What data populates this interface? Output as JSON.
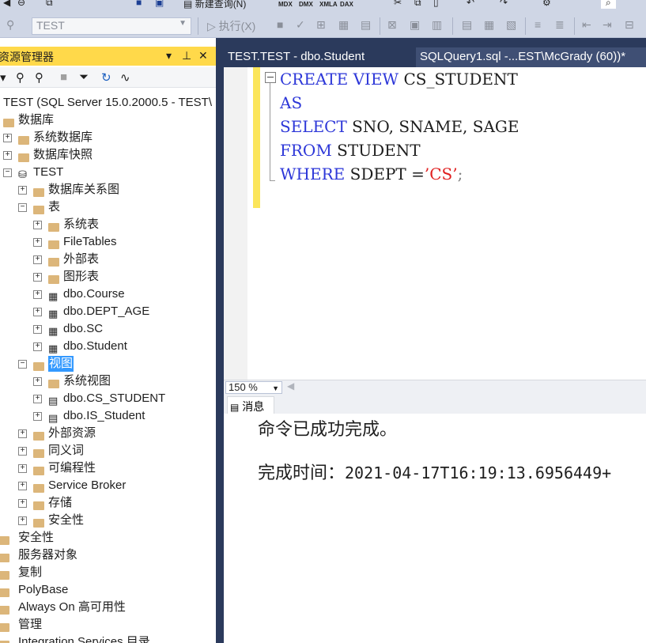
{
  "toolbar": {
    "new_query_label": "新建查询(N)",
    "mdx": "MDX",
    "dmx": "DMX",
    "xmla": "XMLA",
    "dax": "DAX",
    "database_selected": "TEST",
    "execute_label": "执行(X)"
  },
  "object_explorer": {
    "title": "资源管理器",
    "pin_icon": "pin-icon",
    "close_icon": "close-icon"
  },
  "tree": [
    {
      "label": "TEST (SQL Server 15.0.2000.5 - TEST\\",
      "icon": "server-icon"
    },
    {
      "label": "数据库",
      "icon": "folder-icon"
    },
    {
      "label": "系统数据库",
      "icon": "folder-icon"
    },
    {
      "label": "数据库快照",
      "icon": "folder-icon"
    },
    {
      "label": "TEST",
      "icon": "database-icon"
    },
    {
      "label": "数据库关系图",
      "icon": "folder-icon"
    },
    {
      "label": "表",
      "icon": "folder-icon"
    },
    {
      "label": "系统表",
      "icon": "folder-icon"
    },
    {
      "label": "FileTables",
      "icon": "folder-icon"
    },
    {
      "label": "外部表",
      "icon": "folder-icon"
    },
    {
      "label": "图形表",
      "icon": "folder-icon"
    },
    {
      "label": "dbo.Course",
      "icon": "table-icon"
    },
    {
      "label": "dbo.DEPT_AGE",
      "icon": "table-icon"
    },
    {
      "label": "dbo.SC",
      "icon": "table-icon"
    },
    {
      "label": "dbo.Student",
      "icon": "table-icon"
    },
    {
      "label": "视图",
      "icon": "folder-icon"
    },
    {
      "label": "系统视图",
      "icon": "folder-icon"
    },
    {
      "label": "dbo.CS_STUDENT",
      "icon": "view-icon"
    },
    {
      "label": "dbo.IS_Student",
      "icon": "view-icon"
    },
    {
      "label": "外部资源",
      "icon": "folder-icon"
    },
    {
      "label": "同义词",
      "icon": "folder-icon"
    },
    {
      "label": "可编程性",
      "icon": "folder-icon"
    },
    {
      "label": "Service Broker",
      "icon": "folder-icon"
    },
    {
      "label": "存储",
      "icon": "folder-icon"
    },
    {
      "label": "安全性",
      "icon": "folder-icon"
    },
    {
      "label": "安全性",
      "icon": "folder-icon"
    },
    {
      "label": "服务器对象",
      "icon": "folder-icon"
    },
    {
      "label": "复制",
      "icon": "folder-icon"
    },
    {
      "label": "PolyBase",
      "icon": "folder-icon"
    },
    {
      "label": "Always On 高可用性",
      "icon": "folder-icon"
    },
    {
      "label": "管理",
      "icon": "folder-icon"
    },
    {
      "label": "Integration Services 目录",
      "icon": "folder-icon"
    }
  ],
  "tabs": [
    {
      "label": "TEST.TEST - dbo.Student"
    },
    {
      "label": "SQLQuery1.sql -...EST\\McGrady (60))*"
    }
  ],
  "editor": {
    "line1_kw1": "CREATE",
    "line1_kw2": "VIEW",
    "line1_name": " CS_STUDENT",
    "line2_kw": "AS",
    "line3_kw": "SELECT",
    "line3_rest": " SNO, SNAME, SAGE",
    "line4_kw": "FROM",
    "line4_rest": " STUDENT",
    "line5_kw": "WHERE",
    "line5_rest": " SDEPT =",
    "line5_str": "’CS’",
    "line5_end": ";"
  },
  "zoom": "150 %",
  "results": {
    "tab_label": "消息",
    "message": "命令已成功完成。",
    "completion_label": "完成时间：",
    "completion_time": "2021-04-17T16:19:13.6956449+"
  },
  "colors": {
    "keyword": "#2d37d8",
    "string": "#e02020",
    "selection": "#3399ff",
    "title_bar": "#ffd94a",
    "tab_bar": "#2b3a5c"
  }
}
